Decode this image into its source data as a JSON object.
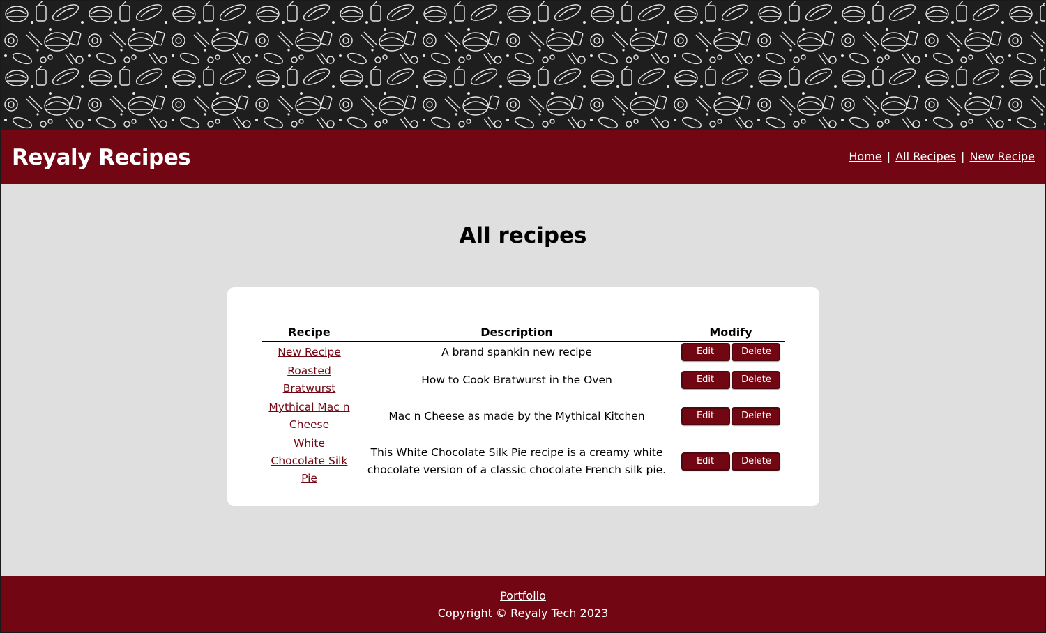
{
  "header": {
    "brand": "Reyaly Recipes",
    "nav": [
      {
        "label": "Home"
      },
      {
        "label": "All Recipes"
      },
      {
        "label": "New Recipe"
      }
    ],
    "separator": "|"
  },
  "main": {
    "title": "All recipes",
    "table": {
      "columns": [
        "Recipe",
        "Description",
        "Modify"
      ],
      "rows": [
        {
          "name": "New Recipe",
          "description": "A brand spankin new recipe"
        },
        {
          "name": "Roasted Bratwurst",
          "description": "How to Cook Bratwurst in the Oven"
        },
        {
          "name": "Mythical Mac n Cheese",
          "description": "Mac n Cheese as made by the Mythical Kitchen"
        },
        {
          "name": "White Chocolate Silk Pie",
          "description": "This White Chocolate Silk Pie recipe is a creamy white chocolate version of a classic chocolate French silk pie."
        }
      ],
      "edit_label": "Edit",
      "delete_label": "Delete"
    }
  },
  "footer": {
    "portfolio_label": "Portfolio",
    "copyright": "Copyright © Reyaly Tech 2023"
  },
  "colors": {
    "brand": "#720713",
    "background": "#dfdfdf",
    "banner": "#1e1e1e"
  }
}
